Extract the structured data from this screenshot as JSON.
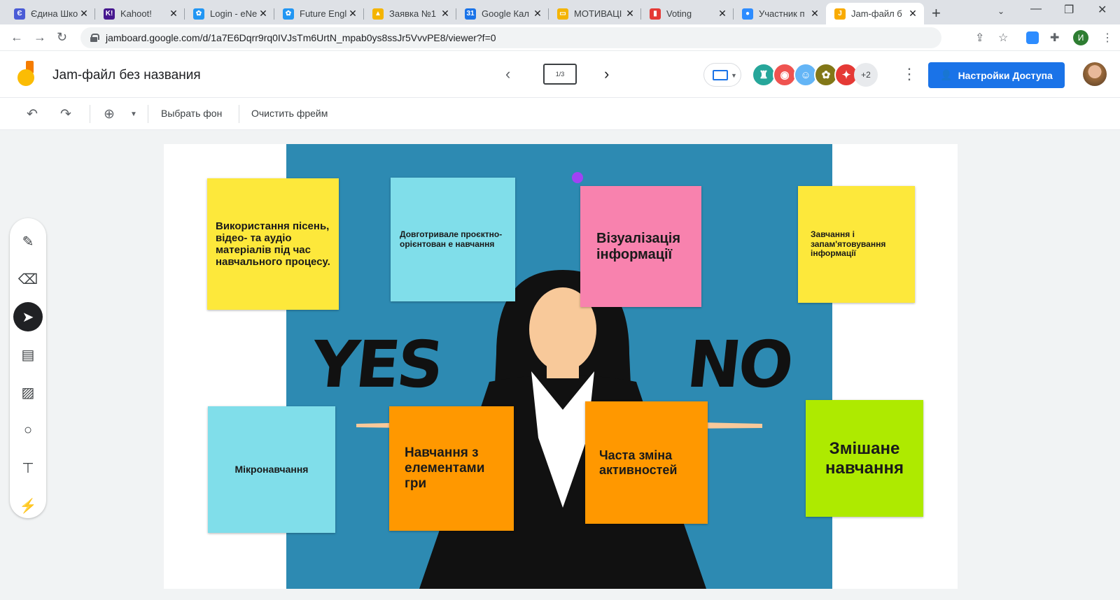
{
  "browser": {
    "tabs": [
      {
        "title": "Єдина Шко",
        "color": "#4a5bd6",
        "glyph": "Є"
      },
      {
        "title": "Kahoot!",
        "color": "#46178f",
        "glyph": "K!"
      },
      {
        "title": "Login - eNe",
        "color": "#2196f3",
        "glyph": "✿"
      },
      {
        "title": "Future Engl",
        "color": "#2196f3",
        "glyph": "✿"
      },
      {
        "title": "Заявка №1",
        "color": "#f4b400",
        "glyph": "▲"
      },
      {
        "title": "Google Кал",
        "color": "#1a73e8",
        "glyph": "31"
      },
      {
        "title": "МОТИВАЦІ",
        "color": "#f4b400",
        "glyph": "▭"
      },
      {
        "title": "Voting",
        "color": "#e53935",
        "glyph": "▮"
      },
      {
        "title": "Участник п",
        "color": "#2d8cff",
        "glyph": "●"
      },
      {
        "title": "Jam-файл б",
        "color": "#f9ab00",
        "glyph": "J"
      }
    ],
    "url": "jamboard.google.com/d/1a7E6Dqrr9rq0IVJsTm6UrtN_mpab0ys8ssJr5VvvPE8/viewer?f=0",
    "profile_initial": "И"
  },
  "header": {
    "title": "Jam-файл без названия",
    "frame_indicator": "1/3",
    "extra_collaborators": "+2",
    "share_label": "Настройки Доступа",
    "collaborators": [
      {
        "color": "#26a69a",
        "glyph": "♜"
      },
      {
        "color": "#ef5350",
        "glyph": "◉"
      },
      {
        "color": "#64b5f6",
        "glyph": "☺"
      },
      {
        "color": "#827717",
        "glyph": "✿"
      },
      {
        "color": "#e53935",
        "glyph": "✦"
      }
    ]
  },
  "toolbar": {
    "background_label": "Выбрать фон",
    "clear_label": "Очистить фрейм"
  },
  "board": {
    "yes_text": "YES",
    "no_text": "NO",
    "notes": [
      {
        "text": "Використання пісень, відео- та аудіо матеріалів під час навчального процесу.",
        "color": "#fde83b"
      },
      {
        "text": "Довготривале проєктно-орієнтован е навчання",
        "color": "#80deea"
      },
      {
        "text": "Візуалізація інформації",
        "color": "#f882ae"
      },
      {
        "text": "Завчання і запам'ятовування інформації",
        "color": "#fde83b"
      },
      {
        "text": "Мікронавчання",
        "color": "#80deea"
      },
      {
        "text": "Навчання з елементами гри",
        "color": "#ff9800"
      },
      {
        "text": "Часта зміна активностей",
        "color": "#ff9800"
      },
      {
        "text": "Змішане навчання",
        "color": "#aeea00"
      }
    ]
  }
}
